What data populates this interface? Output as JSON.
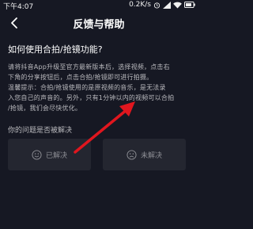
{
  "status_bar": {
    "time": "下午4:07",
    "network_speed": "0.2K/s",
    "icons": [
      "alarm-icon",
      "signal-icon",
      "wifi-icon",
      "battery-icon"
    ]
  },
  "nav": {
    "back_icon": "back-arrow-icon",
    "title": "反馈与帮助"
  },
  "question": {
    "title": "如何使用合拍/抢镜功能?",
    "answer_line_1": "请将抖音App升级至官方最新版本后，选择视频，点击右",
    "answer_line_2": "下角的分享按钮后，点击合拍/抢镜即可进行拍摄。",
    "answer_line_3": "温馨提示：合拍/抢镜使用的是原视频的音乐，是无法录",
    "answer_line_4": "入您自己的声音的。另外，只有1分钟以内的视频可以合拍",
    "answer_line_5": "/抢镜，我们会尽快优化。"
  },
  "feedback": {
    "prompt": "你的问题是否被解决",
    "resolved_label": "已解决",
    "resolved_icon": "smile-face-icon",
    "unresolved_label": "未解决",
    "unresolved_icon": "sad-face-icon"
  },
  "colors": {
    "background": "#161823",
    "button_background": "#242630",
    "annotation_arrow": "#e0161e"
  }
}
